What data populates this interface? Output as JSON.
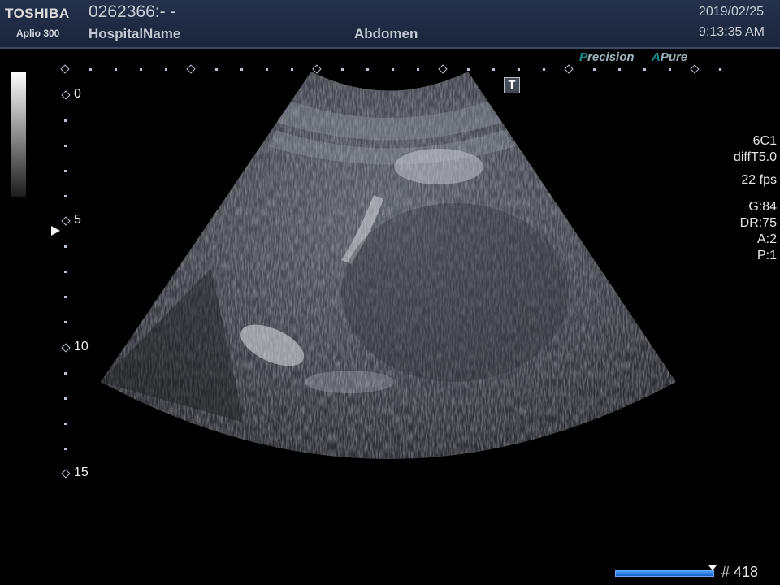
{
  "header": {
    "brand": "TOSHIBA",
    "model": "Aplio 300",
    "patient_id": "0262366:- -",
    "hospital": "HospitalName",
    "preset": "Abdomen",
    "date": "2019/02/25",
    "time": "9:13:35 AM"
  },
  "image_mode": {
    "precision_initial": "P",
    "precision_rest": "recision",
    "apure_initial": "A",
    "apure_rest": "Pure",
    "t_marker": "T"
  },
  "depth_scale": {
    "labels": [
      "0",
      "5",
      "10",
      "15"
    ],
    "unit_count": 15
  },
  "params": {
    "probe": "6C1",
    "filter": "diffT5.0",
    "fps": "22 fps",
    "gain": "G:84",
    "dynamic_range": "DR:75",
    "a": "A:2",
    "p": "P:1"
  },
  "cine": {
    "frame_label": "# 418"
  },
  "colors": {
    "header_bg": "#25324c",
    "accent_teal": "#1a8f95",
    "cine_blue": "#1f6fdc"
  }
}
